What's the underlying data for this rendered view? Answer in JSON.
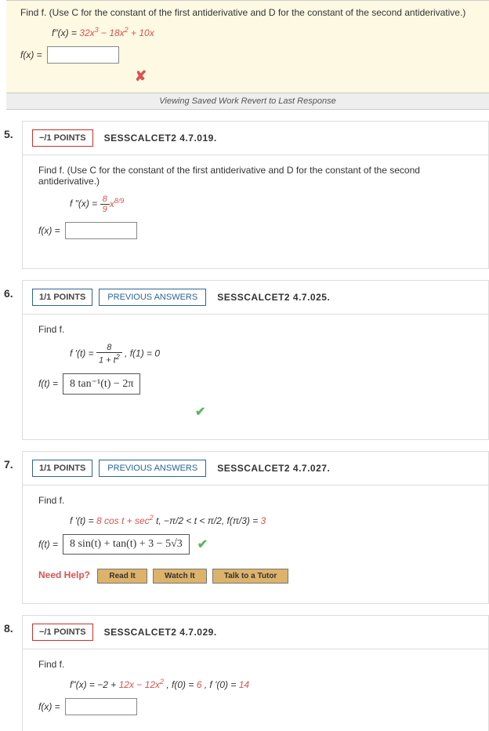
{
  "top": {
    "prompt": "Find f. (Use C for the constant of the first antiderivative and D for the constant of the second antiderivative.)",
    "formula_lhs": "f\"(x) = ",
    "formula_rhs_a": "32x",
    "formula_rhs_b": "3",
    "formula_rhs_c": " − 18x",
    "formula_rhs_d": "2",
    "formula_rhs_e": " + 10x",
    "answer_label": "f(x) =",
    "viewing": "Viewing Saved Work Revert to Last Response"
  },
  "q5": {
    "num": "5.",
    "points": "−/1 POINTS",
    "code": "SESSCALCET2 4.7.019.",
    "prompt": "Find f. (Use C for the constant of the first antiderivative and D for the constant of the second antiderivative.)",
    "formula_lhs": "f \"(x) = ",
    "frac_num": "8",
    "frac_den": "9",
    "formula_rhs": "x",
    "exp": "8/9",
    "answer_label": "f(x) ="
  },
  "q6": {
    "num": "6.",
    "points": "1/1 POINTS",
    "prev": "PREVIOUS ANSWERS",
    "code": "SESSCALCET2 4.7.025.",
    "prompt": "Find f.",
    "deriv_lhs": "f '(t) = ",
    "deriv_frac_num": "8",
    "deriv_frac_den": "1 + t",
    "deriv_frac_den_exp": "2",
    "cond": ",    f(1) = 0",
    "answer_label": "f(t) =",
    "answer_value": "8 tan⁻¹(t) − 2π"
  },
  "q7": {
    "num": "7.",
    "points": "1/1 POINTS",
    "prev": "PREVIOUS ANSWERS",
    "code": "SESSCALCET2 4.7.027.",
    "prompt": "Find f.",
    "deriv_a": "f '(t) = ",
    "deriv_b": "8 cos t + sec",
    "deriv_exp": "2",
    "deriv_c": "t,    −π/2 < t < π/2,    f(π/3) = ",
    "deriv_d": "3",
    "answer_label": "f(t) =",
    "answer_value": "8 sin(t) + tan(t) + 3 − 5√3",
    "help_label": "Need Help?",
    "read": "Read It",
    "watch": "Watch It",
    "tutor": "Talk to a Tutor"
  },
  "q8": {
    "num": "8.",
    "points": "−/1 POINTS",
    "code": "SESSCALCET2 4.7.029.",
    "prompt": "Find f.",
    "formula_a": "f\"(x) = −2 + ",
    "formula_b": "12x − 12x",
    "formula_exp": "2",
    "formula_c": ",    f(0) = ",
    "formula_d": "6",
    "formula_e": ",    f '(0) = ",
    "formula_f": "14",
    "answer_label": "f(x) ="
  }
}
